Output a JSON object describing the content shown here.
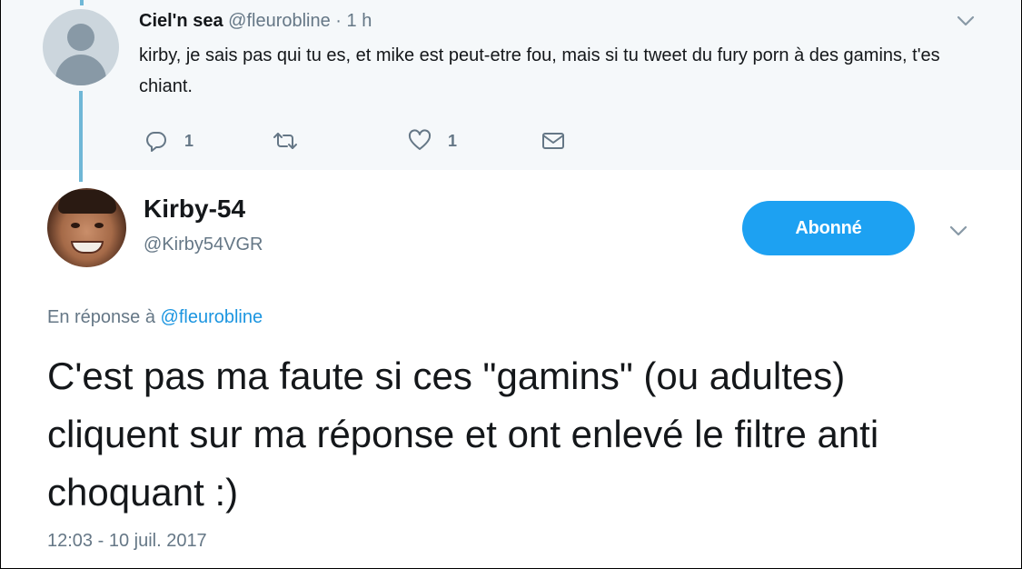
{
  "parent_tweet": {
    "name": "Ciel'n sea",
    "handle": "@fleurobline",
    "separator": "·",
    "time": "1 h",
    "text": "kirby, je sais pas qui tu es, et mike est peut-etre fou, mais si tu tweet du fury porn à des gamins, t'es chiant.",
    "actions": {
      "reply_icon": "reply-icon",
      "reply_count": "1",
      "retweet_icon": "retweet-icon",
      "retweet_count": "",
      "like_icon": "heart-icon",
      "like_count": "1",
      "dm_icon": "envelope-icon"
    }
  },
  "main_tweet": {
    "name": "Kirby-54",
    "handle": "@Kirby54VGR",
    "follow_label": "Abonné",
    "reply_prefix": "En réponse à ",
    "reply_mention": "@fleurobline",
    "text": "C'est pas ma faute si ces \"gamins\" (ou adultes) cliquent sur ma réponse et ont enlevé le filtre anti choquant :)",
    "timestamp": "12:03 - 10 juil. 2017"
  },
  "colors": {
    "accent": "#1da1f2",
    "mention": "#1b95e0",
    "muted": "#657786",
    "parent_bg": "#f5f8fa",
    "thread_line": "#6fb7d6"
  }
}
